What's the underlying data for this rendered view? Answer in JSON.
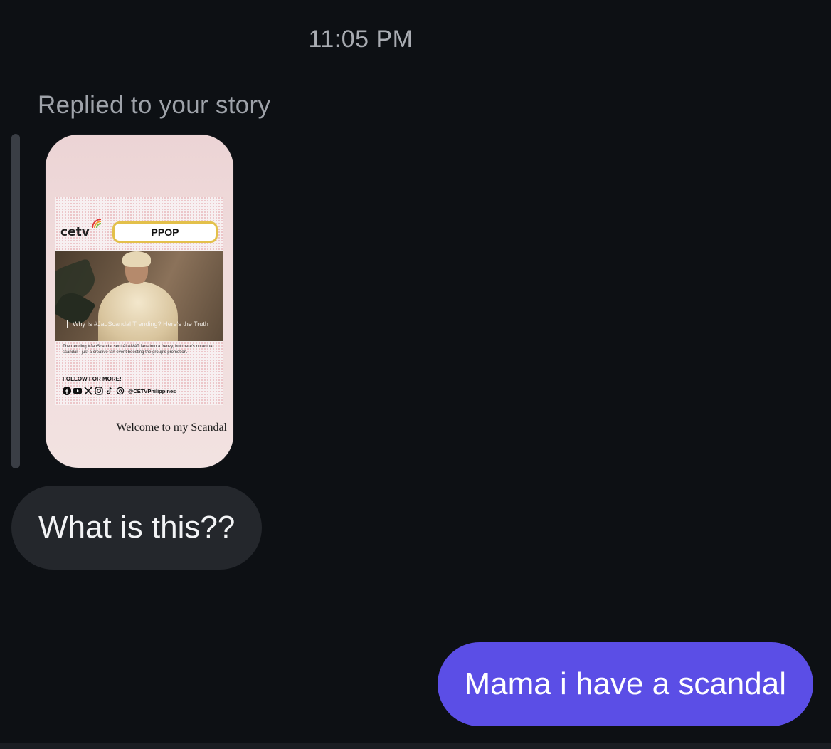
{
  "thread": {
    "timestamp": "11:05 PM",
    "reply_label": "Replied to your story"
  },
  "story": {
    "brand": "cetv",
    "category_badge": "PPOP",
    "headline": "Why Is #JaoScandal Trending? Here's the Truth",
    "body_text": "The trending #JaoScandal sent ALAMAT fans into a frenzy, but there's no actual scandal—just a creative fan event boosting the group's promotion.",
    "follow_title": "FOLLOW FOR MORE!",
    "social_handle": "@CETVPhilippines",
    "social_icons": [
      "facebook-icon",
      "youtube-icon",
      "x-icon",
      "instagram-icon",
      "tiktok-icon",
      "threads-icon"
    ],
    "caption": "Welcome to my Scandal"
  },
  "messages": [
    {
      "direction": "incoming",
      "text": "What is this??"
    },
    {
      "direction": "outgoing",
      "text": "Mama i have a scandal"
    }
  ],
  "colors": {
    "background": "#0d1014",
    "incoming_bubble": "#24272c",
    "outgoing_bubble": "#5b4ee6",
    "badge_border": "#e3c04a"
  }
}
